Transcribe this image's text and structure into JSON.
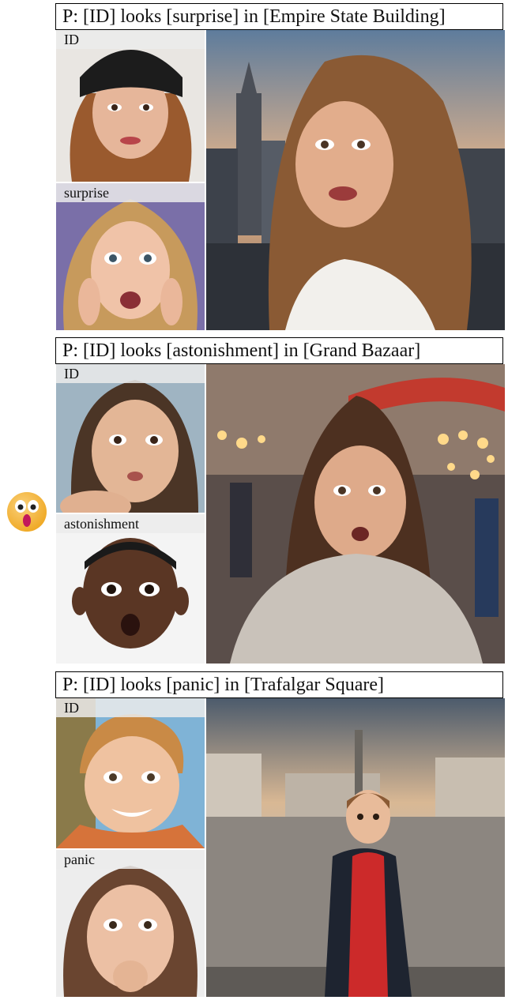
{
  "figure": {
    "examples": [
      {
        "prompt": "P: [ID] looks [surprise] in [Empire State Building]",
        "id_label": "ID",
        "expression_label": "surprise"
      },
      {
        "prompt": "P: [ID] looks [astonishment] in [Grand Bazaar]",
        "id_label": "ID",
        "expression_label": "astonishment"
      },
      {
        "prompt": "P: [ID] looks [panic] in [Trafalgar Square]",
        "id_label": "ID",
        "expression_label": "panic"
      }
    ]
  },
  "icons": {
    "side_emoji": "astonished-face-icon"
  },
  "colors": {
    "emoji_face": "#f7b733",
    "emoji_mouth": "#c2185b"
  }
}
